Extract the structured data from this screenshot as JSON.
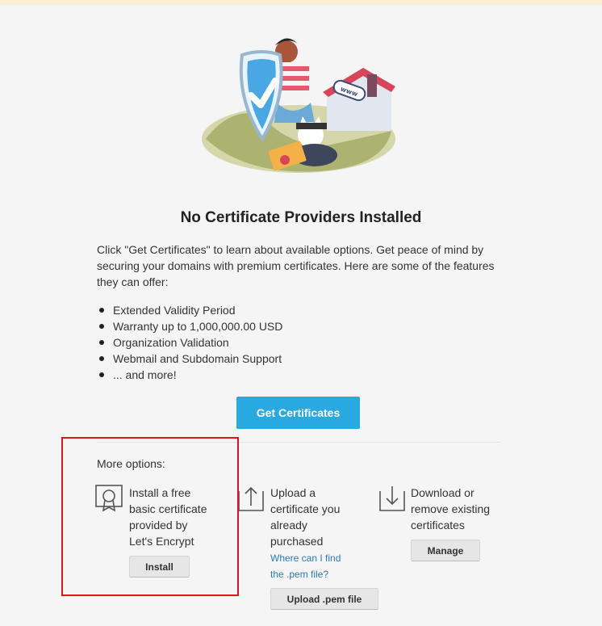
{
  "hero": {
    "illustration": "shield-checkmark-illustration",
    "sign_text": "www"
  },
  "title": "No Certificate Providers Installed",
  "description": "Click \"Get Certificates\" to learn about available options. Get peace of mind by securing your domains with premium certificates. Here are some of the features they can offer:",
  "features": [
    "Extended Validity Period",
    "Warranty up to 1,000,000.00 USD",
    "Organization Validation",
    "Webmail and Subdomain Support",
    "... and more!"
  ],
  "get_certificates_label": "Get Certificates",
  "more_options_label": "More options:",
  "options": {
    "letsencrypt": {
      "icon": "certificate-ribbon-icon",
      "line1": "Install a free",
      "line2": "basic certificate",
      "line3": "provided by",
      "line4": "Let's Encrypt",
      "button": "Install"
    },
    "upload": {
      "icon": "upload-icon",
      "line1": "Upload a",
      "line2": "certificate you",
      "line3": "already",
      "line4": "purchased",
      "link1": "Where can I find",
      "link2": "the .pem file?",
      "button": "Upload .pem file"
    },
    "manage": {
      "icon": "download-icon",
      "line1": "Download or",
      "line2": "remove existing",
      "line3": "certificates",
      "button": "Manage"
    }
  },
  "colors": {
    "primary": "#28aae1",
    "highlight": "#e0151b",
    "link": "#2b7bb9",
    "background": "#f5f5f5"
  }
}
